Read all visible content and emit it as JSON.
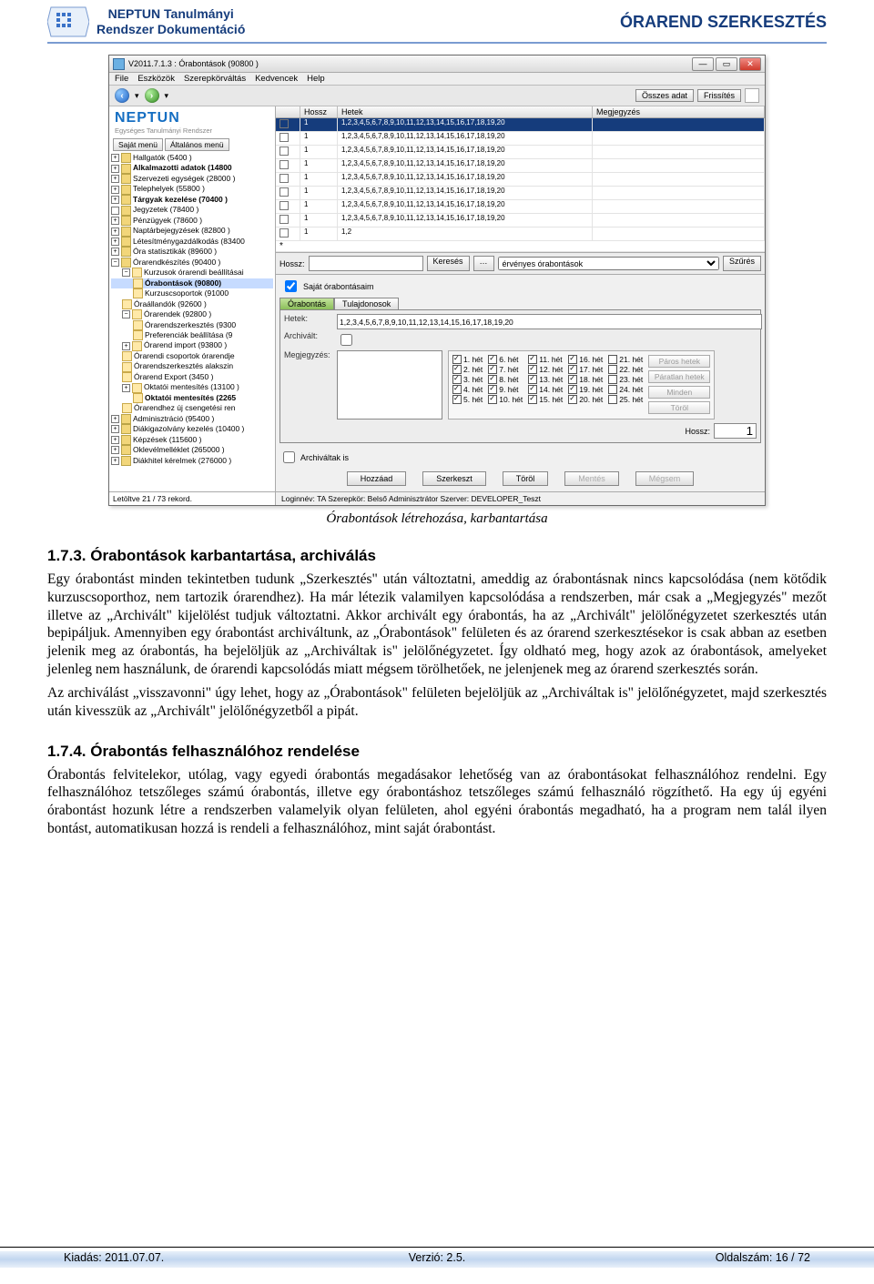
{
  "header": {
    "title_line1": "NEPTUN Tanulmányi",
    "title_line2": "Rendszer Dokumentáció",
    "right_title": "ÓRAREND SZERKESZTÉS"
  },
  "app": {
    "window_title": "V2011.7.1.3 : Órabontások (90800 )",
    "menus": [
      "File",
      "Eszközök",
      "Szerepkörváltás",
      "Kedvencek",
      "Help"
    ],
    "toolbar": {
      "all_data": "Összes adat",
      "refresh": "Frissítés"
    },
    "logo_line1": "NEPTUN",
    "logo_line2": "Egységes Tanulmányi Rendszer",
    "menu_tabs": {
      "own": "Saját menü",
      "general": "Általános menü"
    },
    "tree": [
      "Hallgatók (5400 )",
      "Alkalmazotti adatok (14800",
      "Szervezeti egységek (28000 )",
      "Telephelyek (55800 )",
      "Tárgyak kezelése (70400 )",
      "Jegyzetek (78400 )",
      "Pénzügyek (78600 )",
      "Naptárbejegyzések (82800 )",
      "Létesítménygazdálkodás (83400",
      "Óra statisztikák (89600 )",
      "Órarendkészítés (90400 )",
      "Kurzusok órarendi beállításai",
      "Órabontások (90800)",
      "Kurzuscsoportok (91000",
      "Óraállandók (92600 )",
      "Órarendek (92800 )",
      "Órarendszerkesztés (9300",
      "Preferenciák beállítása (9",
      "Órarend import (93800 )",
      "Órarendi csoportok órarendje",
      "Órarendszerkesztés alakszin",
      "Órarend Export (3450 )",
      "Oktatói mentesítés (13100 )",
      "Oktatói mentesítés (2265",
      "Órarendhez új csengetési ren",
      "Adminisztráció (95400 )",
      "Diákigazolvány kezelés (10400 )",
      "Képzések (115600 )",
      "Oklevélmelléklet (265000 )",
      "Diákhitel kérelmek (276000 )"
    ],
    "status_left": "Letöltve 21 / 73 rekord.",
    "grid": {
      "cols": [
        "",
        "Hossz",
        "Hetek",
        "Megjegyzés"
      ],
      "hossz": "1",
      "hetek_full": "1,2,3,4,5,6,7,8,9,10,11,12,13,14,15,16,17,18,19,20",
      "hetek_short": "1,2"
    },
    "filter": {
      "label1": "Hossz:",
      "search_btn": "Keresés",
      "dots": "…",
      "combo": "érvényes órabontások",
      "szures": "Szűrés"
    },
    "own_cb": "Saját órabontásaim",
    "tabs": {
      "t1": "Órabontás",
      "t2": "Tulajdonosok"
    },
    "detail": {
      "hetek_label": "Hetek:",
      "hetek_value": "1,2,3,4,5,6,7,8,9,10,11,12,13,14,15,16,17,18,19,20",
      "archivalt_label": "Archivált:",
      "meg_label": "Megjegyzés:",
      "weeks": {
        "c1": [
          "1. hét",
          "2. hét",
          "3. hét",
          "4. hét",
          "5. hét"
        ],
        "c2": [
          "6. hét",
          "7. hét",
          "8. hét",
          "9. hét",
          "10. hét"
        ],
        "c3": [
          "11. hét",
          "12. hét",
          "13. hét",
          "14. hét",
          "15. hét"
        ],
        "c4": [
          "16. hét",
          "17. hét",
          "18. hét",
          "19. hét",
          "20. hét"
        ],
        "c5": [
          "21. hét",
          "22. hét",
          "23. hét",
          "24. hét",
          "25. hét"
        ]
      },
      "sidebtn": {
        "paros": "Páros hetek",
        "paratlan": "Páratlan hetek",
        "minden": "Minden",
        "torol": "Töröl"
      },
      "hossz_lbl": "Hossz:",
      "hossz_val": "1"
    },
    "arch_cb": "Archiváltak is",
    "buttons": {
      "add": "Hozzáad",
      "edit": "Szerkeszt",
      "del": "Töröl",
      "save": "Mentés",
      "cancel": "Mégsem"
    },
    "statusbar": "Loginnév: TA   Szerepkör: Belső Adminisztrátor   Szerver: DEVELOPER_Teszt"
  },
  "fig_caption": "Órabontások létrehozása, karbantartása",
  "section1": {
    "title": "1.7.3. Órabontások karbantartása, archiválás",
    "p1": "Egy órabontást minden tekintetben tudunk „Szerkesztés\" után változtatni, ameddig az órabontásnak nincs kapcsolódása (nem kötődik kurzuscsoporthoz, nem tartozik órarendhez). Ha már létezik valamilyen kapcsolódása a rendszerben, már csak a „Megjegyzés\" mezőt illetve az „Archivált\" kijelölést tudjuk változtatni. Akkor archivált egy órabontás, ha az „Archivált\" jelölőnégyzetet szerkesztés után bepipáljuk. Amennyiben egy órabontást archiváltunk, az „Órabontások\" felületen és az órarend szerkesztésekor is csak abban az esetben jelenik meg az órabontás, ha bejelöljük az „Archiváltak is\" jelölőnégyzetet. Így oldható meg, hogy azok az órabontások, amelyeket jelenleg nem használunk, de órarendi kapcsolódás miatt mégsem törölhetőek, ne jelenjenek meg az órarend szerkesztés során.",
    "p2": "Az archiválást „visszavonni\" úgy lehet, hogy az „Órabontások\" felületen bejelöljük az „Archiváltak is\" jelölőnégyzetet, majd szerkesztés után kivesszük az „Archivált\" jelölőnégyzetből a pipát."
  },
  "section2": {
    "title": "1.7.4. Órabontás felhasználóhoz rendelése",
    "p1": "Órabontás felvitelekor, utólag, vagy egyedi órabontás megadásakor lehetőség van az órabontásokat felhasználóhoz rendelni. Egy felhasználóhoz tetszőleges számú órabontás, illetve egy órabontáshoz tetszőleges számú felhasználó rögzíthető. Ha egy új egyéni órabontást hozunk létre a rendszerben valamelyik olyan felületen, ahol egyéni órabontás megadható, ha a program nem talál ilyen bontást, automatikusan hozzá is rendeli a felhasználóhoz, mint saját órabontást."
  },
  "footer": {
    "left": "Kiadás: 2011.07.07.",
    "center": "Verzió: 2.5.",
    "right": "Oldalszám: 16 / 72"
  }
}
